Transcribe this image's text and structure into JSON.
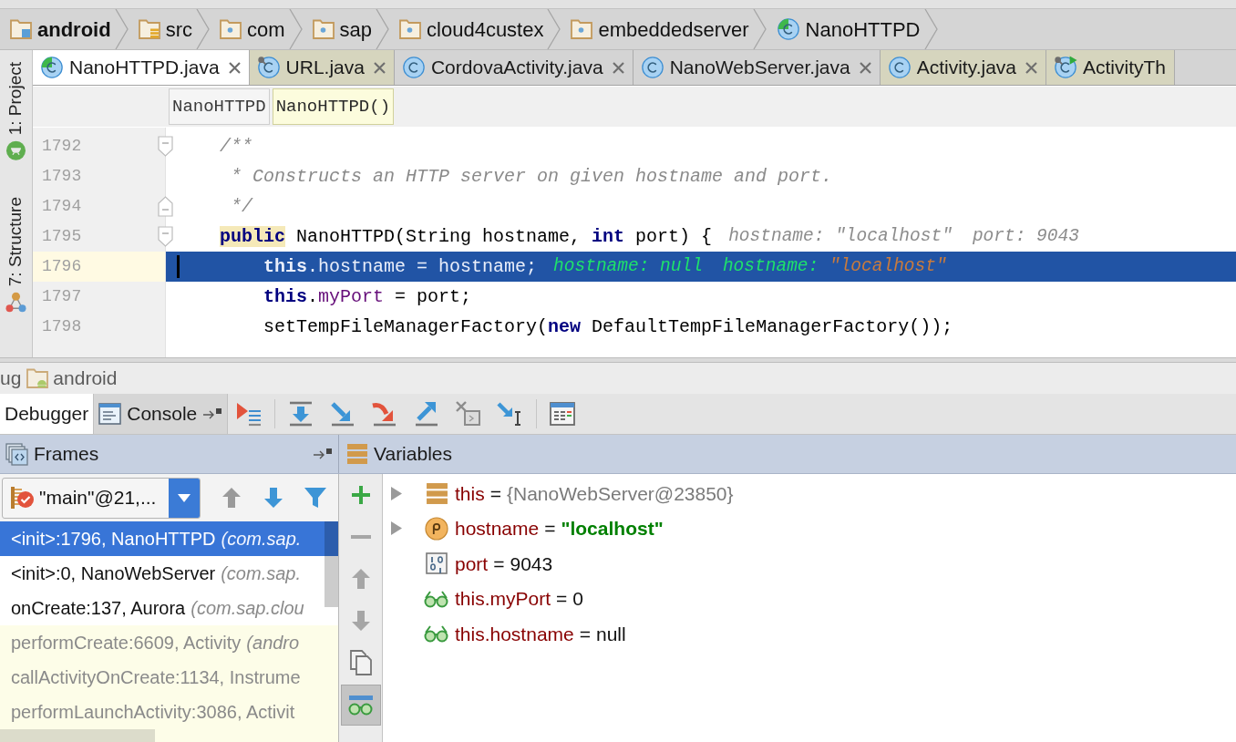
{
  "breadcrumbs": [
    {
      "label": "android",
      "kind": "module"
    },
    {
      "label": "src",
      "kind": "source"
    },
    {
      "label": "com",
      "kind": "package"
    },
    {
      "label": "sap",
      "kind": "package"
    },
    {
      "label": "cloud4custex",
      "kind": "package"
    },
    {
      "label": "embeddedserver",
      "kind": "package"
    },
    {
      "label": "NanoHTTPD",
      "kind": "class"
    }
  ],
  "side_tools": [
    {
      "label": "1: Project",
      "kind": "project"
    },
    {
      "label": "7: Structure",
      "kind": "structure"
    }
  ],
  "editor_tabs": [
    {
      "label": "NanoHTTPD.java",
      "kind": "tracked",
      "selected": true,
      "closable": true
    },
    {
      "label": "URL.java",
      "kind": "locked",
      "selected": false,
      "closable": true,
      "color": "#d6d5be"
    },
    {
      "label": "CordovaActivity.java",
      "kind": "plain",
      "selected": false,
      "closable": true,
      "color": "#d4d4d4"
    },
    {
      "label": "NanoWebServer.java",
      "kind": "plain",
      "selected": false,
      "closable": true,
      "color": "#d4d4d4"
    },
    {
      "label": "Activity.java",
      "kind": "plain",
      "selected": false,
      "closable": true,
      "color": "#d6d5be"
    },
    {
      "label": "ActivityTh",
      "kind": "runnable",
      "selected": false,
      "closable": false,
      "color": "#d6d5be"
    }
  ],
  "navigation": [
    {
      "label": "NanoHTTPD",
      "selected": false
    },
    {
      "label": "NanoHTTPD()",
      "selected": true
    }
  ],
  "code_lines": [
    {
      "number": "1792",
      "selected": false,
      "fold": {
        "kind": "start"
      },
      "code": [
        {
          "text": "    /**",
          "kind": "comment"
        }
      ]
    },
    {
      "number": "1793",
      "selected": false,
      "code": [
        {
          "text": "     * Constructs an HTTP server on given hostname and port.",
          "kind": "comment"
        }
      ]
    },
    {
      "number": "1794",
      "selected": false,
      "fold": {
        "kind": "end"
      },
      "code": [
        {
          "text": "     */",
          "kind": "comment"
        }
      ]
    },
    {
      "number": "1795",
      "selected": false,
      "fold": {
        "kind": "start"
      },
      "code": [
        {
          "text": "    public",
          "kind": "marked"
        },
        {
          "text": " NanoHTTPD(String hostname, ",
          "kind": "plain"
        },
        {
          "text": "int",
          "kind": "keyword"
        },
        {
          "text": " port) {",
          "kind": "plain"
        }
      ],
      "hints": [
        [
          {
            "text": "hostname: \"localhost\"",
            "kind": "hint"
          }
        ],
        [
          {
            "text": "port: 9043",
            "kind": "hint"
          }
        ]
      ]
    },
    {
      "number": "1796",
      "selected": true,
      "code": [
        {
          "text": "        this",
          "kind": "keyword"
        },
        {
          "text": ".",
          "kind": "plain"
        },
        {
          "text": "hostname",
          "kind": "field"
        },
        {
          "text": " = hostname;",
          "kind": "plain"
        }
      ],
      "hints": [
        [
          {
            "text": "hostname: null",
            "kind": "debug"
          }
        ],
        [
          {
            "text": "hostname: ",
            "kind": "debug"
          },
          {
            "text": "\"localhost\"",
            "kind": "debugstring"
          }
        ]
      ]
    },
    {
      "number": "1797",
      "selected": false,
      "code": [
        {
          "text": "        this",
          "kind": "keyword"
        },
        {
          "text": ".",
          "kind": "plain"
        },
        {
          "text": "myPort",
          "kind": "field"
        },
        {
          "text": " = port;",
          "kind": "plain"
        }
      ]
    },
    {
      "number": "1798",
      "selected": false,
      "code": [
        {
          "text": "        setTempFileManagerFactory(",
          "kind": "plain"
        },
        {
          "text": "new",
          "kind": "keyword"
        },
        {
          "text": " DefaultTempFileManagerFactory());",
          "kind": "plain"
        }
      ]
    }
  ],
  "debug_window": {
    "title_fragment": "ug",
    "title": "android"
  },
  "debug_tabs": [
    {
      "label": "Debugger",
      "kind": "debugger",
      "selected": true
    },
    {
      "label": "Console",
      "kind": "console",
      "selected": false
    }
  ],
  "frames": {
    "title": "Frames",
    "thread": "\"main\"@21,...",
    "items": [
      {
        "method": "<init>:1796, NanoHTTPD",
        "location": "(com.sap.",
        "kind": "app",
        "selected": true
      },
      {
        "method": "<init>:0, NanoWebServer",
        "location": "(com.sap.",
        "kind": "app",
        "selected": false
      },
      {
        "method": "onCreate:137, Aurora",
        "location": "(com.sap.clou",
        "kind": "app",
        "selected": false
      },
      {
        "method": "performCreate:6609, Activity",
        "location": "(andro",
        "kind": "library",
        "selected": false
      },
      {
        "method": "callActivityOnCreate:1134, Instrume",
        "kind": "library",
        "selected": false
      },
      {
        "method": "performLaunchActivity:3086, Activit",
        "kind": "library",
        "selected": false
      }
    ]
  },
  "variables": {
    "title": "Variables",
    "watches_on": true,
    "items": [
      {
        "name": "this",
        "operator": "=",
        "value": {
          "text": "{NanoWebServer@23850}",
          "kind": "object"
        },
        "kind": "field",
        "expandable": true
      },
      {
        "name": "hostname",
        "operator": "=",
        "value": {
          "text": "\"localhost\"",
          "kind": "string"
        },
        "kind": "parameter",
        "expandable": true
      },
      {
        "name": "port",
        "operator": "=",
        "value": {
          "text": "9043",
          "kind": "plain"
        },
        "kind": "primitive",
        "expandable": false
      },
      {
        "name": "this.myPort",
        "operator": "=",
        "value": {
          "text": "0",
          "kind": "plain"
        },
        "kind": "watch",
        "expandable": false
      },
      {
        "name": "this.hostname",
        "operator": "=",
        "value": {
          "text": "null",
          "kind": "plain"
        },
        "kind": "watch",
        "expandable": false
      }
    ]
  }
}
